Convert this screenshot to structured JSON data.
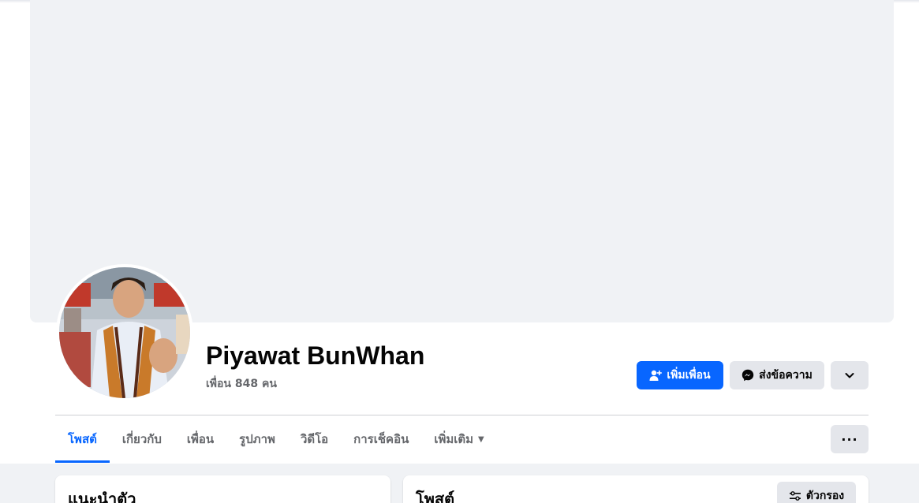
{
  "profile": {
    "name": "Piyawat BunWhan",
    "friends": "เพื่อน 848 คน"
  },
  "actions": {
    "add_friend": "เพิ่มเพื่อน",
    "message": "ส่งข้อความ"
  },
  "tabs": [
    {
      "label": "โพสต์",
      "active": true
    },
    {
      "label": "เกี่ยวกับ"
    },
    {
      "label": "เพื่อน"
    },
    {
      "label": "รูปภาพ"
    },
    {
      "label": "วิดีโอ"
    },
    {
      "label": "การเช็คอิน"
    },
    {
      "label": "เพิ่มเติม"
    }
  ],
  "cards": {
    "intro_title": "แนะนำตัว",
    "posts_title": "โพสต์",
    "filter_label": "ตัวกรอง"
  },
  "colors": {
    "accent": "#0866ff",
    "secondary_button": "#e4e6eb",
    "page_bg": "#f0f2f5",
    "muted_text": "#65676b"
  },
  "icons": {
    "add_friend": "person-plus-icon",
    "message": "messenger-icon",
    "more": "chevron-down-icon",
    "tab_more": "caret-down-icon",
    "tab_options": "more-dots-icon",
    "filter": "sliders-icon"
  }
}
